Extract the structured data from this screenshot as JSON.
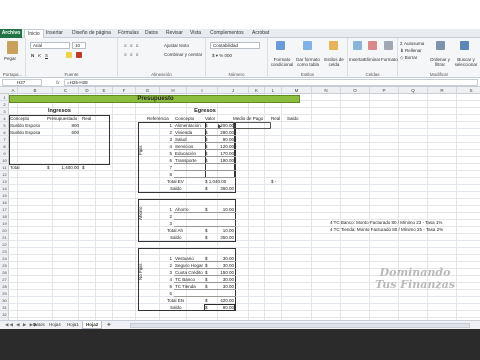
{
  "ribbon": {
    "file_tab": "Archivo",
    "tabs": [
      "Inicio",
      "Insertar",
      "Diseño de página",
      "Fórmulas",
      "Datos",
      "Revisar",
      "Vista",
      "Complementos",
      "Acrobat"
    ],
    "clipboard": {
      "paste": "Pegar",
      "group": "Portapa..."
    },
    "font": {
      "name": "Arial",
      "size": "10",
      "group": "Fuente"
    },
    "alignment": {
      "wrap": "Ajustar texto",
      "merge": "Combinar y centrar",
      "group": "Alineación"
    },
    "number": {
      "format": "Contabilidad",
      "group": "Número"
    },
    "styles": {
      "conditional": "Formato condicional",
      "as_table": "Dar formato como tabla",
      "cell_styles": "Estilos de celda",
      "group": "Estilos"
    },
    "cells": {
      "insert": "Insertar",
      "delete": "Eliminar",
      "format": "Formato",
      "group": "Celdas"
    },
    "editing": {
      "autosum": "Autosuma",
      "fill": "Rellenar",
      "clear": "Borrar",
      "sort": "Ordenar y filtrar",
      "find": "Buscar y seleccionar",
      "group": "Modificar"
    }
  },
  "formula_bar": {
    "name_box": "H27",
    "formula": "=H25-H28"
  },
  "columns": [
    "A",
    "B",
    "C",
    "D",
    "E",
    "F",
    "G",
    "H",
    "I",
    "J",
    "K",
    "L",
    "M",
    "N",
    "O",
    "P",
    "Q",
    "R",
    "S"
  ],
  "rows": [
    "1",
    "2",
    "3",
    "4",
    "5",
    "6",
    "7",
    "8",
    "9",
    "10",
    "11",
    "12",
    "13",
    "14",
    "15",
    "16",
    "17",
    "18",
    "19",
    "20",
    "21",
    "22",
    "23",
    "24",
    "25",
    "26",
    "27",
    "28",
    "29",
    "30",
    "31",
    "32"
  ],
  "sheet": {
    "title": "Presupuesto",
    "ingresos": {
      "title": "Ingresos",
      "headers": [
        "Concepto",
        "Presupuestado",
        "Real"
      ],
      "rows": [
        {
          "concept": "Sueldo Esposo",
          "value": "800"
        },
        {
          "concept": "Sueldo Esposa",
          "value": "600"
        }
      ],
      "total_label": "Total",
      "total_currency": "$",
      "total_value": "1,400.00",
      "total_real": "$"
    },
    "egresos": {
      "title": "Egresos",
      "headers": [
        "Referencia",
        "Concepto",
        "Valor",
        "Medio de Pago",
        "Real",
        "Saldo"
      ],
      "fijos": {
        "label": "Fijos",
        "rows": [
          {
            "n": "1",
            "concept": "Alimentación",
            "value": "200.00"
          },
          {
            "n": "2",
            "concept": "Vivienda",
            "value": "280.00"
          },
          {
            "n": "3",
            "concept": "Salud",
            "value": "80.00"
          },
          {
            "n": "4",
            "concept": "Servicios",
            "value": "120.00"
          },
          {
            "n": "5",
            "concept": "Educación",
            "value": "170.00"
          },
          {
            "n": "6",
            "concept": "Transporte",
            "value": "190.00"
          },
          {
            "n": "7",
            "concept": "",
            "value": ""
          },
          {
            "n": "8",
            "concept": "",
            "value": ""
          }
        ],
        "total_label": "Total EV",
        "total_value": "$ 1,040.00",
        "total_real": "$ -",
        "saldo_label": "Saldo",
        "saldo_value": "360.00"
      },
      "ahorro": {
        "label": "Ahorro",
        "rows": [
          {
            "n": "1",
            "concept": "Ahorro",
            "value": "10.00"
          },
          {
            "n": "2",
            "concept": "",
            "value": ""
          },
          {
            "n": "3",
            "concept": "",
            "value": ""
          }
        ],
        "total_label": "Total Ah",
        "total_value": "10.00",
        "saldo_label": "Saldo",
        "saldo_value": "350.00"
      },
      "nofijos": {
        "label": "No Fijos",
        "rows": [
          {
            "n": "1",
            "concept": "Vestuario",
            "value": "30.00"
          },
          {
            "n": "2",
            "concept": "Seguro Hogar",
            "value": "30.00"
          },
          {
            "n": "3",
            "concept": "Cuota Crédito",
            "value": "150.00"
          },
          {
            "n": "4",
            "concept": "TC Banco",
            "value": "30.00"
          },
          {
            "n": "5",
            "concept": "TC Tienda",
            "value": "30.00"
          },
          {
            "n": "6",
            "concept": "",
            "value": ""
          }
        ],
        "total_label": "Total EN",
        "total_value": "420.00",
        "saldo_label": "Saldo",
        "saldo_value": "80.00"
      }
    },
    "notes": [
      "4 TC Banco: Monto Facturado 80 / Mínimo 23 - Tasa 1%",
      "4 TC Tienda: Monto Facturado 80 / Mínimo 25 - Tasa 2%"
    ],
    "watermark": {
      "line1": "Dominando",
      "line2": "Tus Finanzas"
    }
  },
  "sheet_tabs": [
    "Datos",
    "Hoja4",
    "Hoja1",
    "Hoja2"
  ],
  "colors": {
    "title_green": "#8cbd3f",
    "excel_green": "#217346",
    "watermark": "#b9b9b9"
  }
}
